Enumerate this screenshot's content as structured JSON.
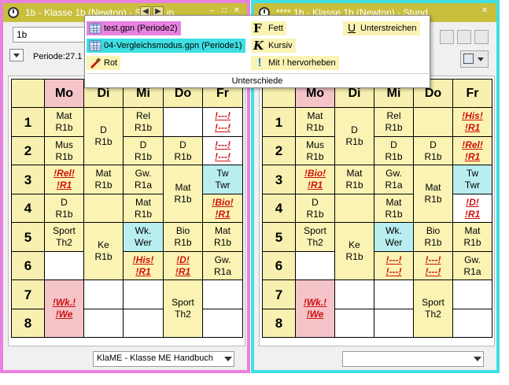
{
  "left": {
    "title": "1b - Klasse 1b (Newton) - St",
    "title_suffix": "in",
    "class_value": "1b",
    "period_label": "Periode:27.1",
    "bottom_combo": "KlaME - Klasse ME Handbuch",
    "days": [
      "Mo",
      "Di",
      "Mi",
      "Do",
      "Fr"
    ],
    "rows": [
      "1",
      "2",
      "3",
      "4",
      "5",
      "6",
      "7",
      "8"
    ],
    "cells": {
      "mo1": [
        "Mat",
        "R1b"
      ],
      "mo2": [
        "Mus",
        "R1b"
      ],
      "mo3": [
        "!Rel!",
        "!R1"
      ],
      "mo4": [
        "D",
        "R1b"
      ],
      "mo5": [
        "Sport",
        "Th2"
      ],
      "mo6": [
        "",
        ""
      ],
      "mo78": [
        "!Wk.!",
        "!We"
      ],
      "di12": [
        "D",
        "R1b"
      ],
      "di3": [
        "Mat",
        "R1b"
      ],
      "di4": [
        "",
        ""
      ],
      "di56": [
        "Ke",
        "R1b"
      ],
      "di6": [
        "",
        ""
      ],
      "di7": [
        "",
        ""
      ],
      "di8": [
        "",
        ""
      ],
      "mi1": [
        "Rel",
        "R1b"
      ],
      "mi2": [
        "D",
        "R1b"
      ],
      "mi3": [
        "Gw.",
        "R1a"
      ],
      "mi4": [
        "Mat",
        "R1b"
      ],
      "mi5": [
        "Wk.",
        "Wer"
      ],
      "mi6": [
        "!His!",
        "!R1"
      ],
      "mi7": [
        "",
        ""
      ],
      "mi8": [
        "",
        ""
      ],
      "do1": [
        "",
        ""
      ],
      "do2": [
        "D",
        "R1b"
      ],
      "do34": [
        "Mat",
        "R1b"
      ],
      "do5": [
        "Bio",
        "R1b"
      ],
      "do6": [
        "!D!",
        "!R1"
      ],
      "do78": [
        "Sport",
        "Th2"
      ],
      "fr1": [
        "!---!",
        "!---!"
      ],
      "fr2": [
        "!---!",
        "!---!"
      ],
      "fr3": [
        "Tw",
        "Twr"
      ],
      "fr4": [
        "!Bio!",
        "!R1"
      ],
      "fr5": [
        "Mat",
        "R1b"
      ],
      "fr6": [
        "Gw.",
        "R1a"
      ],
      "fr7": [
        "",
        ""
      ],
      "fr8": [
        "",
        ""
      ]
    }
  },
  "right": {
    "title": "**** 1b - Klasse 1b (Newton) - Stund",
    "bottom_combo": "",
    "days": [
      "Mo",
      "Di",
      "Mi",
      "Do",
      "Fr"
    ],
    "rows": [
      "1",
      "2",
      "3",
      "4",
      "5",
      "6",
      "7",
      "8"
    ],
    "cells": {
      "mo1": [
        "Mat",
        "R1b"
      ],
      "mo2": [
        "Mus",
        "R1b"
      ],
      "mo3": [
        "!Bio!",
        "!R1"
      ],
      "mo4": [
        "D",
        "R1b"
      ],
      "mo5": [
        "Sport",
        "Th2"
      ],
      "mo6": [
        "",
        ""
      ],
      "mo78": [
        "!Wk.!",
        "!We"
      ],
      "di12": [
        "D",
        "R1b"
      ],
      "di3": [
        "Mat",
        "R1b"
      ],
      "di4": [
        "",
        ""
      ],
      "di56": [
        "Ke",
        "R1b"
      ],
      "di6": [
        "",
        ""
      ],
      "di7": [
        "",
        ""
      ],
      "di8": [
        "",
        ""
      ],
      "mi1": [
        "Rel",
        "R1b"
      ],
      "mi2": [
        "D",
        "R1b"
      ],
      "mi3": [
        "Gw.",
        "R1a"
      ],
      "mi4": [
        "Mat",
        "R1b"
      ],
      "mi5": [
        "Wk.",
        "Wer"
      ],
      "mi6": [
        "!---!",
        "!---!"
      ],
      "mi7": [
        "",
        ""
      ],
      "mi8": [
        "",
        ""
      ],
      "do1": [
        "",
        ""
      ],
      "do2": [
        "D",
        "R1b"
      ],
      "do34": [
        "Mat",
        "R1b"
      ],
      "do5": [
        "Bio",
        "R1b"
      ],
      "do6": [
        "!---!",
        "!---!"
      ],
      "do78": [
        "Sport",
        "Th2"
      ],
      "fr1": [
        "!His!",
        "!R1"
      ],
      "fr2": [
        "!Rel!",
        "!R1"
      ],
      "fr3": [
        "Tw",
        "Twr"
      ],
      "fr4": [
        "!D!",
        "!R1"
      ],
      "fr5": [
        "Mat",
        "R1b"
      ],
      "fr6": [
        "Gw.",
        "R1a"
      ],
      "fr7": [
        "",
        ""
      ],
      "fr8": [
        "",
        ""
      ]
    }
  },
  "popup": {
    "file1": "test.gpn (Periode2)",
    "file2": "04-Vergleichsmodus.gpn (Periode1)",
    "red": "Rot",
    "bold": "Fett",
    "italic": "Kursiv",
    "exclaim": "Mit ! hervorheben",
    "underline": "Unterstreichen",
    "footer": "Unterschiede",
    "colors": {
      "file1": "#e882e0",
      "file2": "#3ee0e4",
      "highlight": "#faf3b4"
    }
  }
}
